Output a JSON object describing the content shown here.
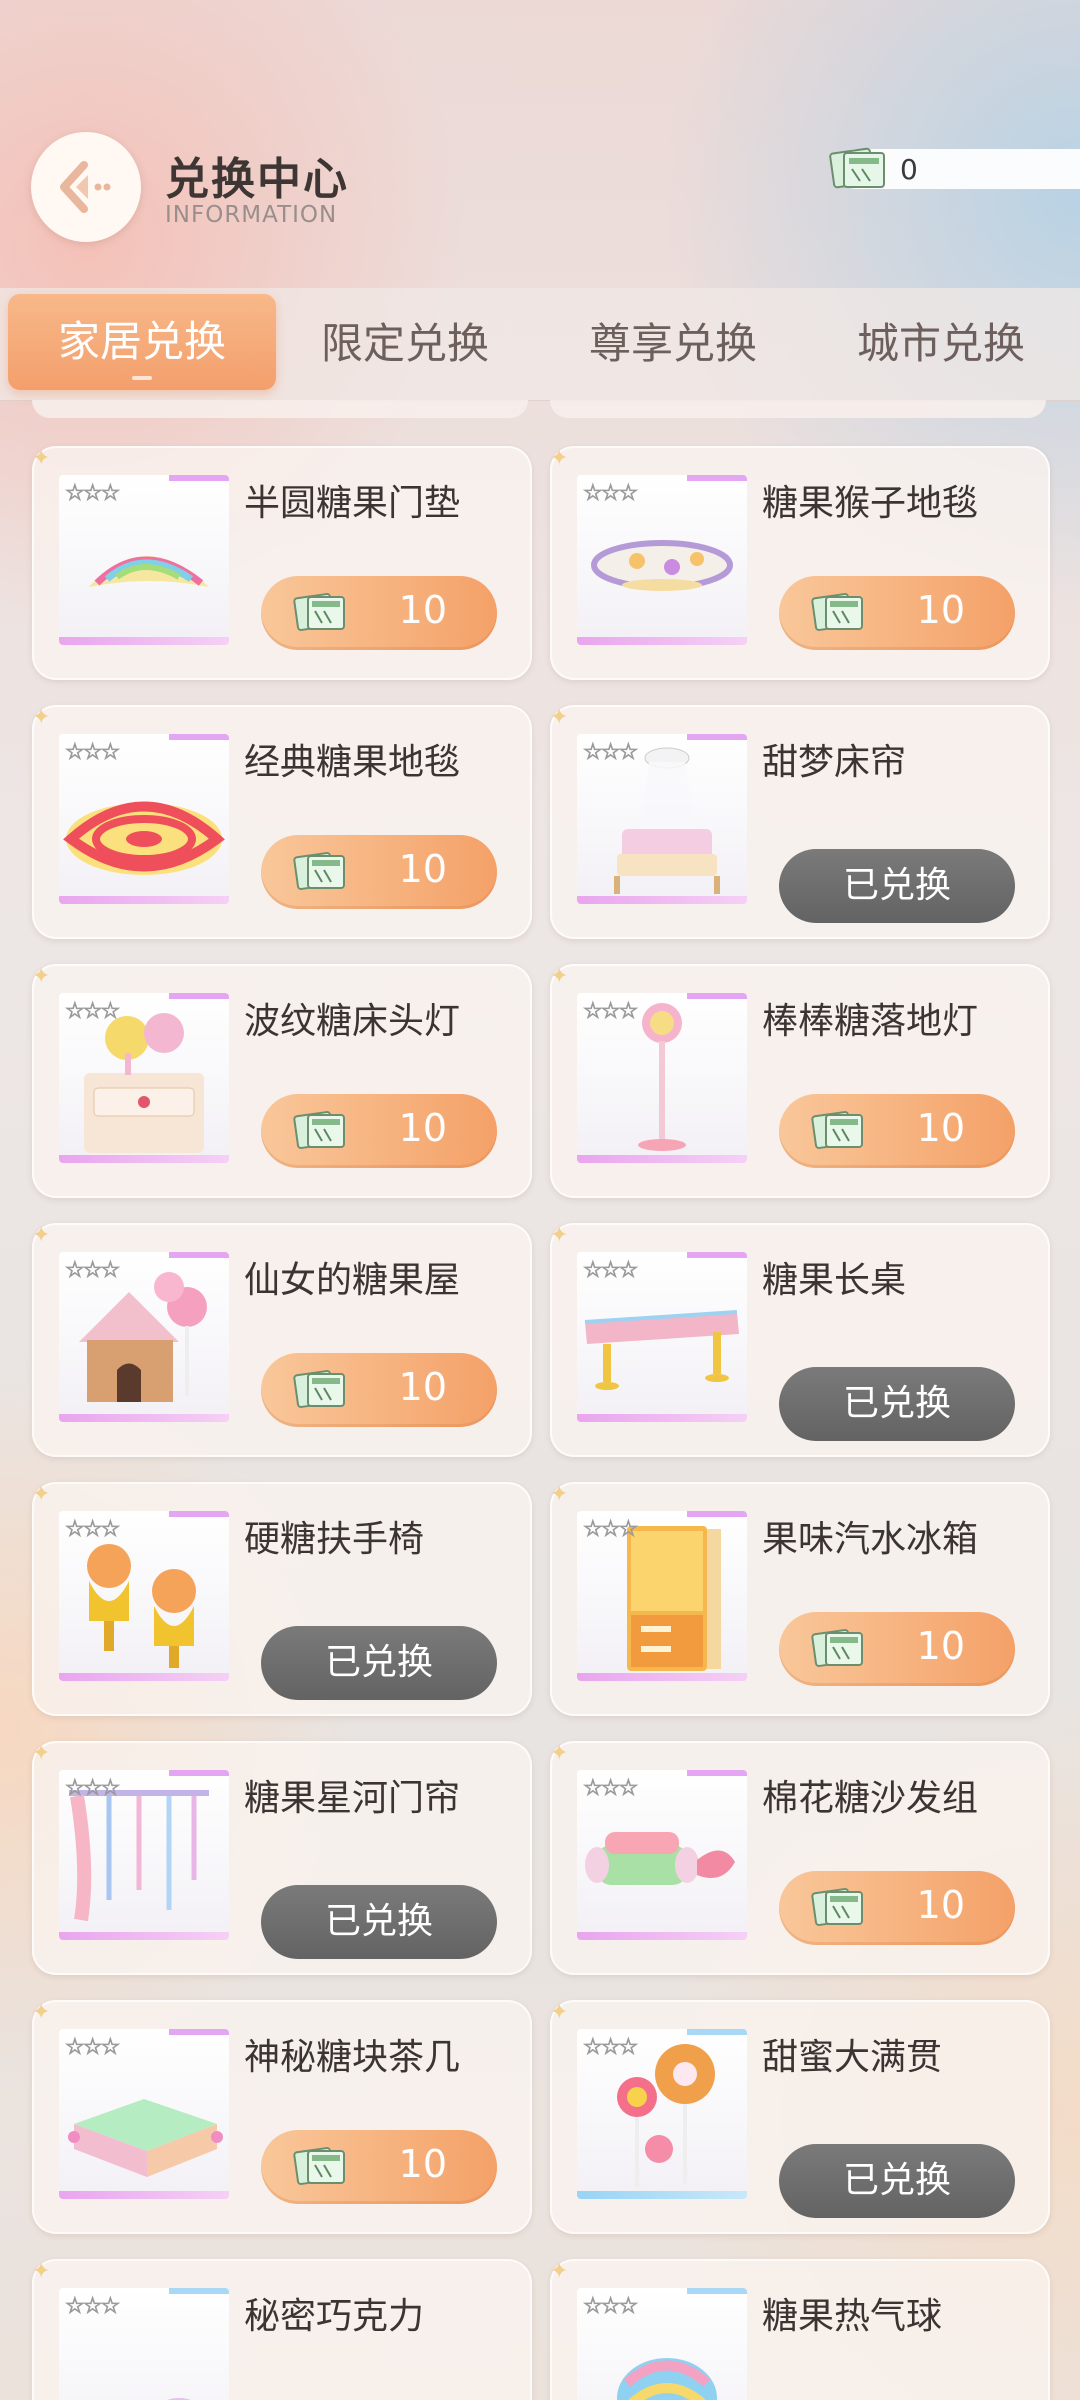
{
  "header": {
    "title": "兑换中心",
    "subtitle": "INFORMATION",
    "currency_count": "0"
  },
  "tabs": [
    "家居兑换",
    "限定兑换",
    "尊享兑换",
    "城市兑换"
  ],
  "active_tab": "家居兑换",
  "items": [
    {
      "name": "半圆糖果门垫",
      "price": "10",
      "status": "price",
      "art": "mat"
    },
    {
      "name": "糖果猴子地毯",
      "price": "10",
      "status": "price",
      "art": "monkey-rug"
    },
    {
      "name": "经典糖果地毯",
      "price": "10",
      "status": "price",
      "art": "swirl-rug"
    },
    {
      "name": "甜梦床帘",
      "done_label": "已兑换",
      "status": "redeemed",
      "art": "bed"
    },
    {
      "name": "波纹糖床头灯",
      "price": "10",
      "status": "price",
      "art": "nightstand"
    },
    {
      "name": "棒棒糖落地灯",
      "price": "10",
      "status": "price",
      "art": "lamp"
    },
    {
      "name": "仙女的糖果屋",
      "price": "10",
      "status": "price",
      "art": "house"
    },
    {
      "name": "糖果长桌",
      "done_label": "已兑换",
      "status": "redeemed",
      "art": "table"
    },
    {
      "name": "硬糖扶手椅",
      "done_label": "已兑换",
      "status": "redeemed",
      "art": "chairs"
    },
    {
      "name": "果味汽水冰箱",
      "price": "10",
      "status": "price",
      "art": "fridge"
    },
    {
      "name": "糖果星河门帘",
      "done_label": "已兑换",
      "status": "redeemed",
      "art": "curtain"
    },
    {
      "name": "棉花糖沙发组",
      "price": "10",
      "status": "price",
      "art": "sofa"
    },
    {
      "name": "神秘糖块茶几",
      "price": "10",
      "status": "price",
      "art": "coffee-table"
    },
    {
      "name": "甜蜜大满贯",
      "done_label": "已兑换",
      "status": "redeemed",
      "art": "lollipops"
    },
    {
      "name": "秘密巧克力",
      "status": "cut",
      "art": "chocolate"
    },
    {
      "name": "糖果热气球",
      "status": "cut",
      "art": "balloon"
    }
  ],
  "colors": {
    "accent": "#f4a168",
    "redeemed": "#6b6b6b",
    "rarity": "#e4a6f2"
  }
}
